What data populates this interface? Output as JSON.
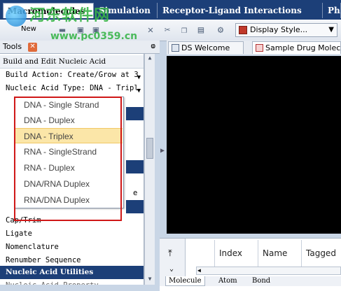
{
  "top_tabs": [
    "Macromolecules",
    "Simulation",
    "Receptor-Ligand Interactions",
    "Pha"
  ],
  "toolbar": {
    "new_label": "New",
    "display_style_label": "Display Style..."
  },
  "tools_panel": {
    "tab_label": "Tools",
    "pin_glyph": "ⱷ",
    "section_title": "Build and Edit Nucleic Acid",
    "build_action_label": "Build Action: Create/Grow at 3",
    "nucleic_acid_type_label": "Nucleic Acid Type: DNA - Tripl",
    "partial_item": "e",
    "items": [
      "Cap/Trim",
      "Ligate",
      "Nomenclature",
      "Renumber Sequence"
    ],
    "utilities_section": "Nucleic Acid Utilities",
    "partial_bottom": "Nucleic Acid Property"
  },
  "dropdown": {
    "options": [
      "DNA - Single Strand",
      "DNA - Duplex",
      "DNA - Triplex",
      "RNA - SingleStrand",
      "RNA - Duplex",
      "DNA/RNA Duplex",
      "RNA/DNA Duplex"
    ],
    "selected_index": 2
  },
  "doc_tabs": [
    "DS Welcome",
    "Sample Drug Molecu"
  ],
  "table": {
    "columns": [
      "Index",
      "Name",
      "Tagged"
    ],
    "bottom_tabs": [
      "Molecule",
      "Atom",
      "Bond"
    ]
  },
  "watermark": {
    "text": "河东软件网",
    "url": "www.pc0359.cn"
  },
  "colors": {
    "accent": "#1c3f78",
    "highlight": "#fbe6a8",
    "annotation_red": "#d01818",
    "watermark_green": "#39b54a"
  }
}
